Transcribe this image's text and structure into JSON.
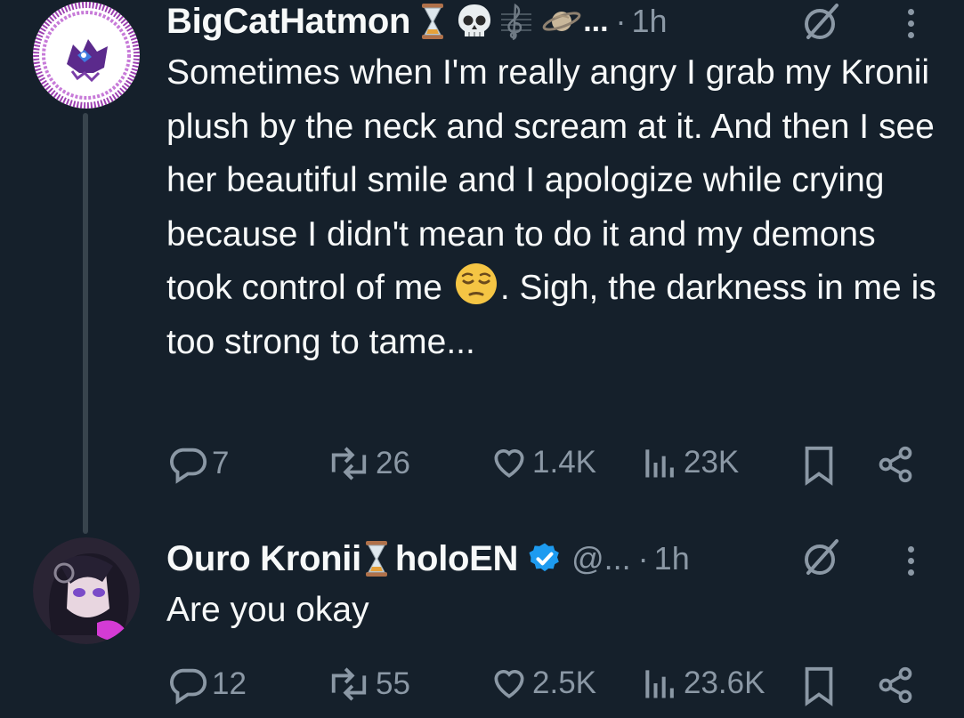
{
  "posts": [
    {
      "display_name": "BigCatHatmon",
      "name_emojis": [
        "hourglass-emoji",
        "skull-emoji",
        "music-clef-emoji",
        "ringed-planet-emoji"
      ],
      "name_truncation": "...",
      "dot": "·",
      "time": "1h",
      "text_before_emoji": "Sometimes when I'm really angry I grab my Kronii plush by the neck and scream at it. And then I see her beautiful smile and I apologize while crying because I didn't mean to do it and my demons took control of me ",
      "inline_emoji": "pensive-face-emoji",
      "text_after_emoji": ". Sigh, the darkness in me is too strong to tame...",
      "stats": {
        "replies": "7",
        "reposts": "26",
        "likes": "1.4K",
        "views": "23K"
      }
    },
    {
      "display_name": "Ouro Kronii",
      "name_emojis": [
        "hourglass-emoji"
      ],
      "name_suffix": "holoEN",
      "verified": true,
      "handle": "@...",
      "dot": "·",
      "time": "1h",
      "text": "Are you okay",
      "stats": {
        "replies": "12",
        "reposts": "55",
        "likes": "2.5K",
        "views": "23.6K"
      }
    }
  ],
  "colors": {
    "background": "#15202b",
    "text_primary": "#f7f9f9",
    "text_secondary": "#8b98a5",
    "verified_blue": "#1d9bf0",
    "thread_line": "#38444d"
  }
}
